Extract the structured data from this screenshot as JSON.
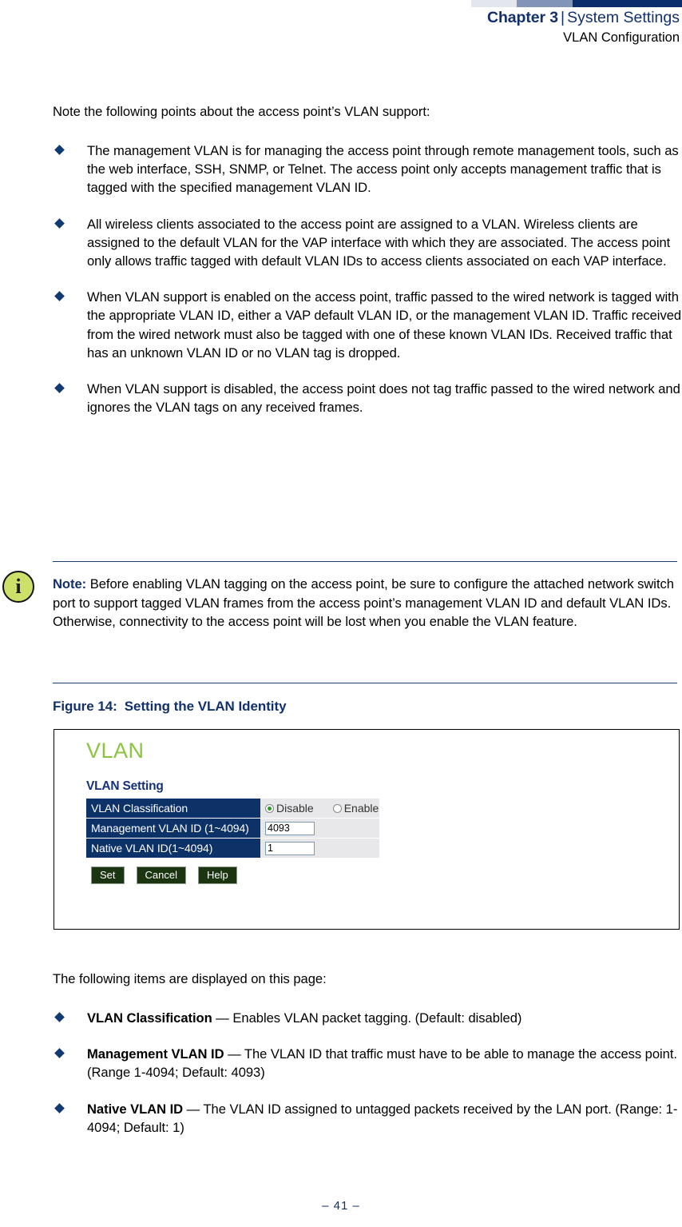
{
  "header": {
    "chapter": "Chapter 3",
    "separator": "|",
    "section": "System Settings",
    "subtitle": "VLAN Configuration",
    "bar_colors": [
      "#e3e7ed",
      "#8295b9",
      "#0b2d6b"
    ]
  },
  "intro": "Note the following points about the access point’s VLAN support:",
  "bullets": [
    "The management VLAN is for managing the access point through remote management tools, such as the web interface, SSH, SNMP, or Telnet. The access point only accepts management traffic that is tagged with the specified management VLAN ID.",
    "All wireless clients associated to the access point are assigned to a VLAN. Wireless clients are assigned to the default VLAN for the VAP interface with which they are associated. The access point only allows traffic tagged with default VLAN IDs to access clients associated on each VAP interface.",
    "When VLAN support is enabled on the access point, traffic passed to the wired network is tagged with the appropriate VLAN ID, either a VAP default VLAN ID, or the management VLAN ID. Traffic received from the wired network must also be tagged with one of these known VLAN IDs. Received traffic that has an unknown VLAN ID or no VLAN tag is dropped.",
    "When VLAN support is disabled, the access point does not tag traffic passed to the wired network and ignores the VLAN tags on any received frames."
  ],
  "note": {
    "icon": "info-icon",
    "icon_glyph": "i",
    "icon_color": "#cde16a",
    "label": "Note:",
    "text": " Before enabling VLAN tagging on the access point, be sure to configure the attached network switch port to support tagged VLAN frames from the access point’s management VLAN ID and default VLAN IDs. Otherwise, connectivity to the access point will be lost when you enable the VLAN feature."
  },
  "figure": {
    "label": "Figure 14:",
    "title": "Setting the VLAN Identity",
    "panel": {
      "title": "VLAN",
      "title_color": "#8bc53f",
      "section_heading": "VLAN Setting",
      "rows": [
        {
          "label": "VLAN Classification",
          "type": "radio",
          "options": [
            {
              "label": "Disable",
              "selected": true
            },
            {
              "label": "Enable",
              "selected": false
            }
          ]
        },
        {
          "label": "Management VLAN ID (1~4094)",
          "type": "text",
          "value": "4093"
        },
        {
          "label": "Native VLAN ID(1~4094)",
          "type": "text",
          "value": "1"
        }
      ],
      "buttons": [
        "Set",
        "Cancel",
        "Help"
      ]
    }
  },
  "lower_intro": "The following items are displayed on this page:",
  "items": [
    {
      "term": "VLAN Classification",
      "desc": " — Enables VLAN packet tagging. (Default: disabled)"
    },
    {
      "term": "Management VLAN ID",
      "desc": " — The VLAN ID that traffic must have to be able to manage the access point. (Range 1-4094; Default: 4093)"
    },
    {
      "term": "Native VLAN ID",
      "desc": " —  The VLAN ID assigned to untagged packets received by the LAN port. (Range: 1-4094; Default: 1)"
    }
  ],
  "footer": {
    "page": "–  41  –"
  }
}
